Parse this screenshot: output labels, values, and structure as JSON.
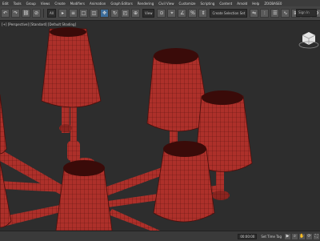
{
  "menu": [
    "Edit",
    "Tools",
    "Group",
    "Views",
    "Create",
    "Modifiers",
    "Animation",
    "Graph Editors",
    "Rendering",
    "Civil View",
    "Customize",
    "Scripting",
    "Content",
    "Arnold",
    "Help",
    "ZOOBASE0"
  ],
  "toolbar": {
    "selection_filter": "All",
    "view_dropdown": "View",
    "named_selection": "Create Selection Set",
    "search_placeholder": "Sign In"
  },
  "viewport": {
    "label": "[+] [Perspective] [Standard] [Default Shading]"
  },
  "status": {
    "left_text": "",
    "time": "00:00:00",
    "autokey": "Set Time Tag"
  },
  "colors": {
    "shade": "#b0322c",
    "wire": "#6a1512",
    "bg": "#2d2d2d"
  }
}
